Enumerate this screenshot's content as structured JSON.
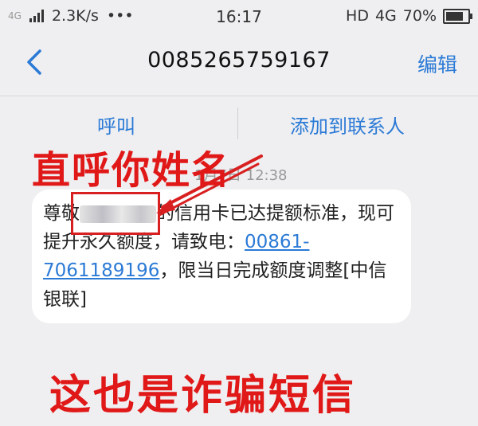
{
  "status_bar": {
    "network_small": "4G",
    "speed": "2.3K/s",
    "dots": "•••",
    "time": "16:17",
    "hd": "HD",
    "net_type": "4G",
    "battery": "70%"
  },
  "nav": {
    "phone_number": "0085265759167",
    "edit_label": "编辑"
  },
  "actions": {
    "call_label": "呼叫",
    "add_contact_label": "添加到联系人"
  },
  "annotations": {
    "name_callout": "直呼你姓名",
    "scam_caption": "这也是诈骗短信"
  },
  "message": {
    "timestamp": "1月7日 12:38",
    "part1": "尊敬",
    "part2": "的信用卡已达提额标准，现可提升永久额度，请致电：",
    "link": "00861-7061189196",
    "part3": "，限当日完成额度调整[中信银联]"
  },
  "colors": {
    "accent": "#2b7ad6",
    "annotation_red": "#e01818"
  }
}
